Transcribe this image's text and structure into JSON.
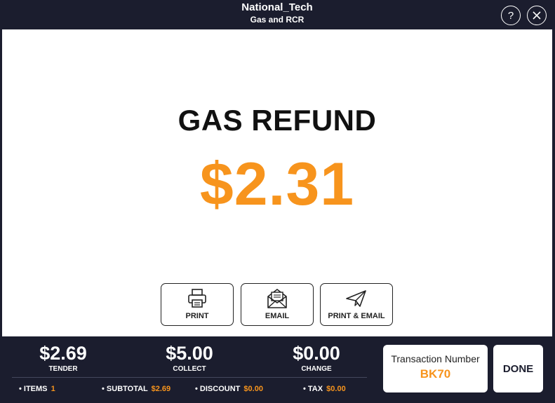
{
  "header": {
    "title": "National_Tech",
    "subtitle": "Gas and RCR",
    "help_icon": "question-icon",
    "close_icon": "close-icon"
  },
  "main": {
    "heading": "GAS REFUND",
    "amount": "$2.31",
    "actions": [
      {
        "label": "PRINT",
        "icon": "printer-icon"
      },
      {
        "label": "EMAIL",
        "icon": "envelope-icon"
      },
      {
        "label": "PRINT & EMAIL",
        "icon": "paper-plane-icon"
      }
    ]
  },
  "footer": {
    "tender": {
      "value": "$2.69",
      "label": "TENDER"
    },
    "collect": {
      "value": "$5.00",
      "label": "COLLECT"
    },
    "change": {
      "value": "$0.00",
      "label": "CHANGE"
    },
    "stats": {
      "items": {
        "label": "• ITEMS",
        "value": "1"
      },
      "subtotal": {
        "label": "• SUBTOTAL",
        "value": "$2.69"
      },
      "discount": {
        "label": "• DISCOUNT",
        "value": "$0.00"
      },
      "tax": {
        "label": "• TAX",
        "value": "$0.00"
      }
    },
    "transaction": {
      "label": "Transaction Number",
      "number": "BK70"
    },
    "done_label": "DONE"
  },
  "colors": {
    "accent": "#f7941d",
    "dark": "#1b1d2e",
    "background": "#ffffff"
  }
}
